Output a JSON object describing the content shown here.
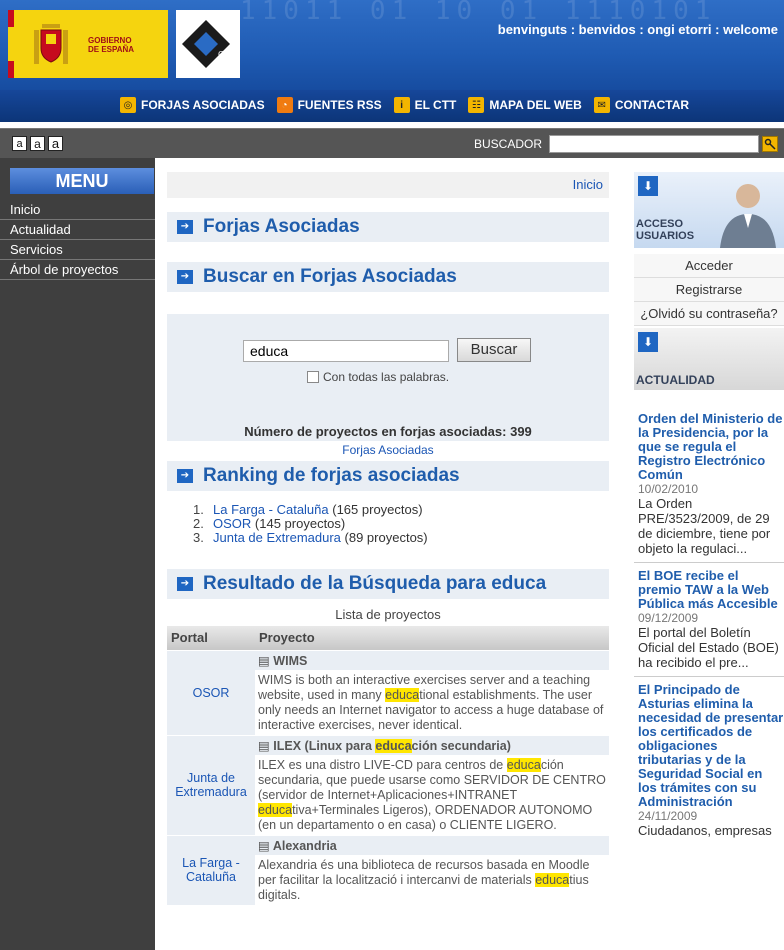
{
  "header": {
    "welcome": "benvinguts : benvidos : ongi etorri : welcome",
    "gov_text": "GOBIERNO\nDE ESPAÑA",
    "nav": [
      {
        "label": "FORJAS ASOCIADAS",
        "icon": "globe-icon"
      },
      {
        "label": "FUENTES RSS",
        "icon": "rss-icon"
      },
      {
        "label": "EL CTT",
        "icon": "info-icon"
      },
      {
        "label": "MAPA DEL WEB",
        "icon": "sitemap-icon"
      },
      {
        "label": "CONTACTAR",
        "icon": "mail-icon"
      }
    ]
  },
  "toolbar": {
    "font_sizes": [
      "a",
      "a",
      "a"
    ],
    "search_label": "BUSCADOR",
    "search_value": ""
  },
  "sidebar": {
    "title": "MENU",
    "items": [
      "Inicio",
      "Actualidad",
      "Servicios",
      "Árbol de proyectos"
    ]
  },
  "main": {
    "breadcrumb": "Inicio",
    "title": "Forjas Asociadas",
    "search_title": "Buscar en Forjas Asociadas",
    "query": "educa",
    "search_button": "Buscar",
    "checkbox_label": "Con todas las palabras.",
    "count_text": "Número de proyectos en forjas asociadas: 399",
    "count_link": "Forjas Asociadas",
    "ranking_title": "Ranking de forjas asociadas",
    "ranking": [
      {
        "num": "1.",
        "name": "La Farga - Cataluña",
        "count": "(165 proyectos)"
      },
      {
        "num": "2.",
        "name": "OSOR",
        "count": "(145 proyectos)"
      },
      {
        "num": "3.",
        "name": "Junta de Extremadura",
        "count": "(89 proyectos)"
      }
    ],
    "results_title": "Resultado de la Búsqueda para educa",
    "results_caption": "Lista de proyectos",
    "columns": [
      "Portal",
      "Proyecto"
    ],
    "results": [
      {
        "portal": "OSOR",
        "title_parts": [
          "WIMS"
        ],
        "desc_parts": [
          "WIMS is both an interactive exercises server and a teaching website, used in many ",
          "educa",
          "tional establishments. The user only needs an Internet navigator to access a huge database of interactive exercises, never identical."
        ]
      },
      {
        "portal": "Junta de Extremadura",
        "title_parts": [
          "ILEX (Linux para ",
          "educa",
          "ción secundaria)"
        ],
        "desc_parts": [
          "ILEX es una distro LIVE-CD para centros de ",
          "educa",
          "ción secundaria, que puede usarse como SERVIDOR DE CENTRO (servidor de Internet+Aplicaciones+INTRANET ",
          "educa",
          "tiva+Terminales Ligeros), ORDENADOR AUTONOMO (en un departamento o en casa) o CLIENTE LIGERO."
        ]
      },
      {
        "portal": "La Farga - Cataluña",
        "title_parts": [
          "Alexandria"
        ],
        "desc_parts": [
          "Alexandria és una biblioteca de recursos basada en Moodle per facilitar la localització i intercanvi de materials ",
          "educa",
          "tius digitals."
        ]
      }
    ]
  },
  "right": {
    "access_label": "ACCESO\nUSUARIOS",
    "buttons": [
      "Acceder",
      "Registrarse",
      "¿Olvidó su contraseña?"
    ],
    "news_label": "ACTUALIDAD",
    "news": [
      {
        "title": "Orden del Ministerio de la Presidencia, por la que se regula el Registro Electrónico Común",
        "date": "10/02/2010",
        "text": "La Orden PRE/3523/2009, de 29 de diciembre, tiene por objeto la regulaci..."
      },
      {
        "title": "El BOE recibe el premio TAW a la Web Pública más Accesible",
        "date": "09/12/2009",
        "text": "El portal del Boletín Oficial del Estado (BOE) ha recibido el pre..."
      },
      {
        "title": "El Principado de Asturias elimina la necesidad de presentar los certificados de obligaciones tributarias y de la Seguridad Social en los trámites con su Administración",
        "date": "24/11/2009",
        "text": "Ciudadanos, empresas"
      }
    ]
  },
  "colors": {
    "accent": "#1f5dac",
    "highlight": "#ffe600",
    "header": "#1f5bb3"
  }
}
